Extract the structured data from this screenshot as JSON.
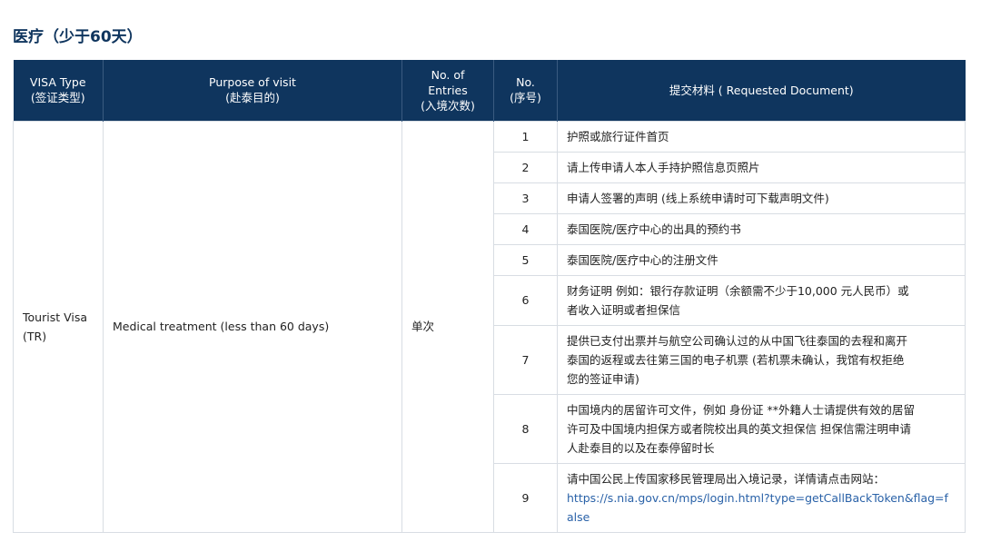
{
  "heading": "医疗（少于60天）",
  "table": {
    "headers": {
      "visa_type": [
        "VISA Type",
        "(签证类型)"
      ],
      "purpose": [
        "Purpose of visit",
        "(赴泰目的)"
      ],
      "entries": [
        "No. of",
        "Entries",
        "(入境次数)"
      ],
      "no": [
        "No.",
        "(序号)"
      ],
      "documents": "提交材料 ( Requested Document)"
    },
    "visa_type": [
      "Tourist Visa",
      "(TR)"
    ],
    "purpose": "Medical treatment (less than 60 days)",
    "entries": "单次",
    "rows": [
      {
        "no": "1",
        "doc": "护照或旅行证件首页"
      },
      {
        "no": "2",
        "doc": "请上传申请人本人手持护照信息页照片"
      },
      {
        "no": "3",
        "doc": "申请人签署的声明 (线上系统申请时可下载声明文件)"
      },
      {
        "no": "4",
        "doc": "泰国医院/医疗中心的出具的预约书"
      },
      {
        "no": "5",
        "doc": "泰国医院/医疗中心的注册文件"
      },
      {
        "no": "6",
        "doc_lines": [
          "财务证明 例如：银行存款证明（余额需不少于10,000 元人民币）或",
          "者收入证明或者担保信"
        ]
      },
      {
        "no": "7",
        "doc_lines": [
          "提供已支付出票并与航空公司确认过的从中国飞往泰国的去程和离开",
          "泰国的返程或去往第三国的电子机票 (若机票未确认，我馆有权拒绝",
          "您的签证申请)"
        ]
      },
      {
        "no": "8",
        "doc_lines": [
          "中国境内的居留许可文件，例如 身份证 **外籍人士请提供有效的居留",
          "许可及中国境内担保方或者院校出具的英文担保信 担保信需注明申请",
          "人赴泰目的以及在泰停留时长"
        ]
      },
      {
        "no": "9",
        "doc_text": "请中国公民上传国家移民管理局出入境记录，详情请点击网站：",
        "link_lines": [
          "https://s.nia.gov.cn/mps/login.html?type=getCallBackToken&flag=f",
          "alse"
        ]
      }
    ]
  }
}
